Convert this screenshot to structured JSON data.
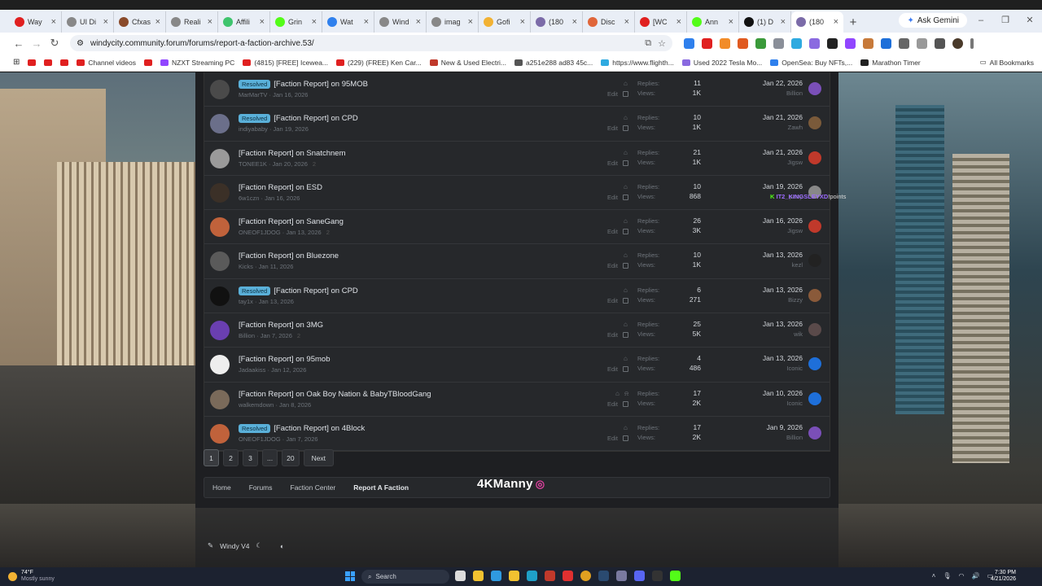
{
  "browser": {
    "tabs": [
      {
        "label": "Way",
        "color": "#e02020"
      },
      {
        "label": "UI Di",
        "color": "#888888"
      },
      {
        "label": "Cfxas",
        "color": "#8a4a2a"
      },
      {
        "label": "Reali",
        "color": "#888888"
      },
      {
        "label": "Affili",
        "color": "#3ec46d"
      },
      {
        "label": "Grin",
        "color": "#53fc18"
      },
      {
        "label": "Wat",
        "color": "#2f80ed"
      },
      {
        "label": "Wind",
        "color": "#888888"
      },
      {
        "label": "imag",
        "color": "#888888"
      },
      {
        "label": "Gofi",
        "color": "#f2b233"
      },
      {
        "label": "(180",
        "color": "#7b6ba8"
      },
      {
        "label": "Disc",
        "color": "#e0663a"
      },
      {
        "label": "[WC",
        "color": "#e02020"
      },
      {
        "label": "Ann",
        "color": "#53fc18"
      },
      {
        "label": "(1) D",
        "color": "#111111"
      },
      {
        "label": "(180",
        "color": "#7b6ba8"
      }
    ],
    "active_tab_index": 15,
    "ask_gemini": "Ask Gemini",
    "url": "windycity.community.forum/forums/report-a-faction-archive.53/",
    "bookmarks": [
      "",
      "",
      "",
      "Channel videos",
      "",
      "NZXT Streaming PC",
      "(4815) [FREE] Icewea...",
      "(229) (FREE) Ken Car...",
      "New & Used Electri...",
      "a251e288 ad83 45c...",
      "https://www.flighth...",
      "Used 2022 Tesla Mo...",
      "OpenSea: Buy NFTs,...",
      "Marathon Timer"
    ],
    "all_bookmarks": "All Bookmarks"
  },
  "forum": {
    "threads": [
      {
        "resolved": true,
        "title": "[Faction Report] on 95MOB",
        "author": "MarMarTV",
        "date": "Jan 16, 2026",
        "pages": "",
        "replies": "11",
        "views": "1K",
        "last_date": "Jan 22, 2026",
        "last_user": "Billion",
        "avatar_color": "#4a4a4a",
        "last_avatar_color": "#7a4fb8"
      },
      {
        "resolved": true,
        "title": "[Faction Report] on CPD",
        "author": "indiyababy",
        "date": "Jan 19, 2026",
        "pages": "",
        "replies": "10",
        "views": "1K",
        "last_date": "Jan 21, 2026",
        "last_user": "Zawh",
        "avatar_color": "#6b6f8a",
        "last_avatar_color": "#7a5a3a"
      },
      {
        "resolved": false,
        "title": "[Faction Report] on Snatchnem",
        "author": "TONEE1K",
        "date": "Jan 20, 2026",
        "pages": "2",
        "replies": "21",
        "views": "1K",
        "last_date": "Jan 21, 2026",
        "last_user": "Jigsw",
        "avatar_color": "#9a9a9a",
        "last_avatar_color": "#c0392b"
      },
      {
        "resolved": false,
        "title": "[Faction Report] on ESD",
        "author": "6w1czn",
        "date": "Jan 16, 2026",
        "pages": "",
        "replies": "10",
        "views": "868",
        "last_date": "Jan 19, 2026",
        "last_user": "party",
        "avatar_color": "#3b3027",
        "last_avatar_color": "#888888"
      },
      {
        "resolved": false,
        "title": "[Faction Report] on SaneGang",
        "author": "ONEOF1JDOG",
        "date": "Jan 13, 2026",
        "pages": "2",
        "replies": "26",
        "views": "3K",
        "last_date": "Jan 16, 2026",
        "last_user": "Jigsw",
        "avatar_color": "#c0623b",
        "last_avatar_color": "#c0392b"
      },
      {
        "resolved": false,
        "title": "[Faction Report] on Bluezone",
        "author": "Kicks",
        "date": "Jan 11, 2026",
        "pages": "",
        "replies": "10",
        "views": "1K",
        "last_date": "Jan 13, 2026",
        "last_user": "kezl",
        "avatar_color": "#5a5a5a",
        "last_avatar_color": "#222222"
      },
      {
        "resolved": true,
        "title": "[Faction Report] on CPD",
        "author": "tay1x",
        "date": "Jan 13, 2026",
        "pages": "",
        "replies": "6",
        "views": "271",
        "last_date": "Jan 13, 2026",
        "last_user": "Bizzy",
        "avatar_color": "#111111",
        "last_avatar_color": "#8a5a3a"
      },
      {
        "resolved": false,
        "title": "[Faction Report] on 3MG",
        "author": "Billion",
        "date": "Jan 7, 2026",
        "pages": "2",
        "replies": "25",
        "views": "5K",
        "last_date": "Jan 13, 2026",
        "last_user": "wik",
        "avatar_color": "#6a3fb0",
        "last_avatar_color": "#5a4a4a"
      },
      {
        "resolved": false,
        "title": "[Faction Report] on 95mob",
        "author": "Jadaakiss",
        "date": "Jan 12, 2026",
        "pages": "",
        "replies": "4",
        "views": "486",
        "last_date": "Jan 13, 2026",
        "last_user": "Iconic",
        "avatar_color": "#eeeeee",
        "last_avatar_color": "#1e6fd9"
      },
      {
        "resolved": false,
        "title": "[Faction Report] on Oak Boy Nation & BabyTBloodGang",
        "author": "walkemdown",
        "date": "Jan 8, 2026",
        "pages": "",
        "replies": "17",
        "views": "2K",
        "last_date": "Jan 10, 2026",
        "last_user": "Iconic",
        "avatar_color": "#7a6a5a",
        "last_avatar_color": "#1e6fd9",
        "watched": true
      },
      {
        "resolved": true,
        "title": "[Faction Report] on 4Block",
        "author": "ONEOF1JDOG",
        "date": "Jan 7, 2026",
        "pages": "",
        "replies": "17",
        "views": "2K",
        "last_date": "Jan 9, 2026",
        "last_user": "Billion",
        "avatar_color": "#c0623b",
        "last_avatar_color": "#7a4fb8"
      }
    ],
    "labels": {
      "resolved": "Resolved",
      "replies": "Replies:",
      "views": "Views:",
      "edit": "Edit"
    },
    "points_overlay": {
      "name": "IT2_KINGSLEYXD",
      "suffix": "!points"
    },
    "pagination": [
      "1",
      "2",
      "3",
      "...",
      "20",
      "Next"
    ],
    "breadcrumbs": [
      "Home",
      "Forums",
      "Faction Center",
      "Report A Faction"
    ],
    "footer_style": "Windy V4"
  },
  "overlay": {
    "watermark": "4KManny"
  },
  "taskbar": {
    "temp": "74°F",
    "weather": "Mostly sunny",
    "search_placeholder": "Search",
    "time": "7:30 PM",
    "date": "4/21/2026"
  }
}
